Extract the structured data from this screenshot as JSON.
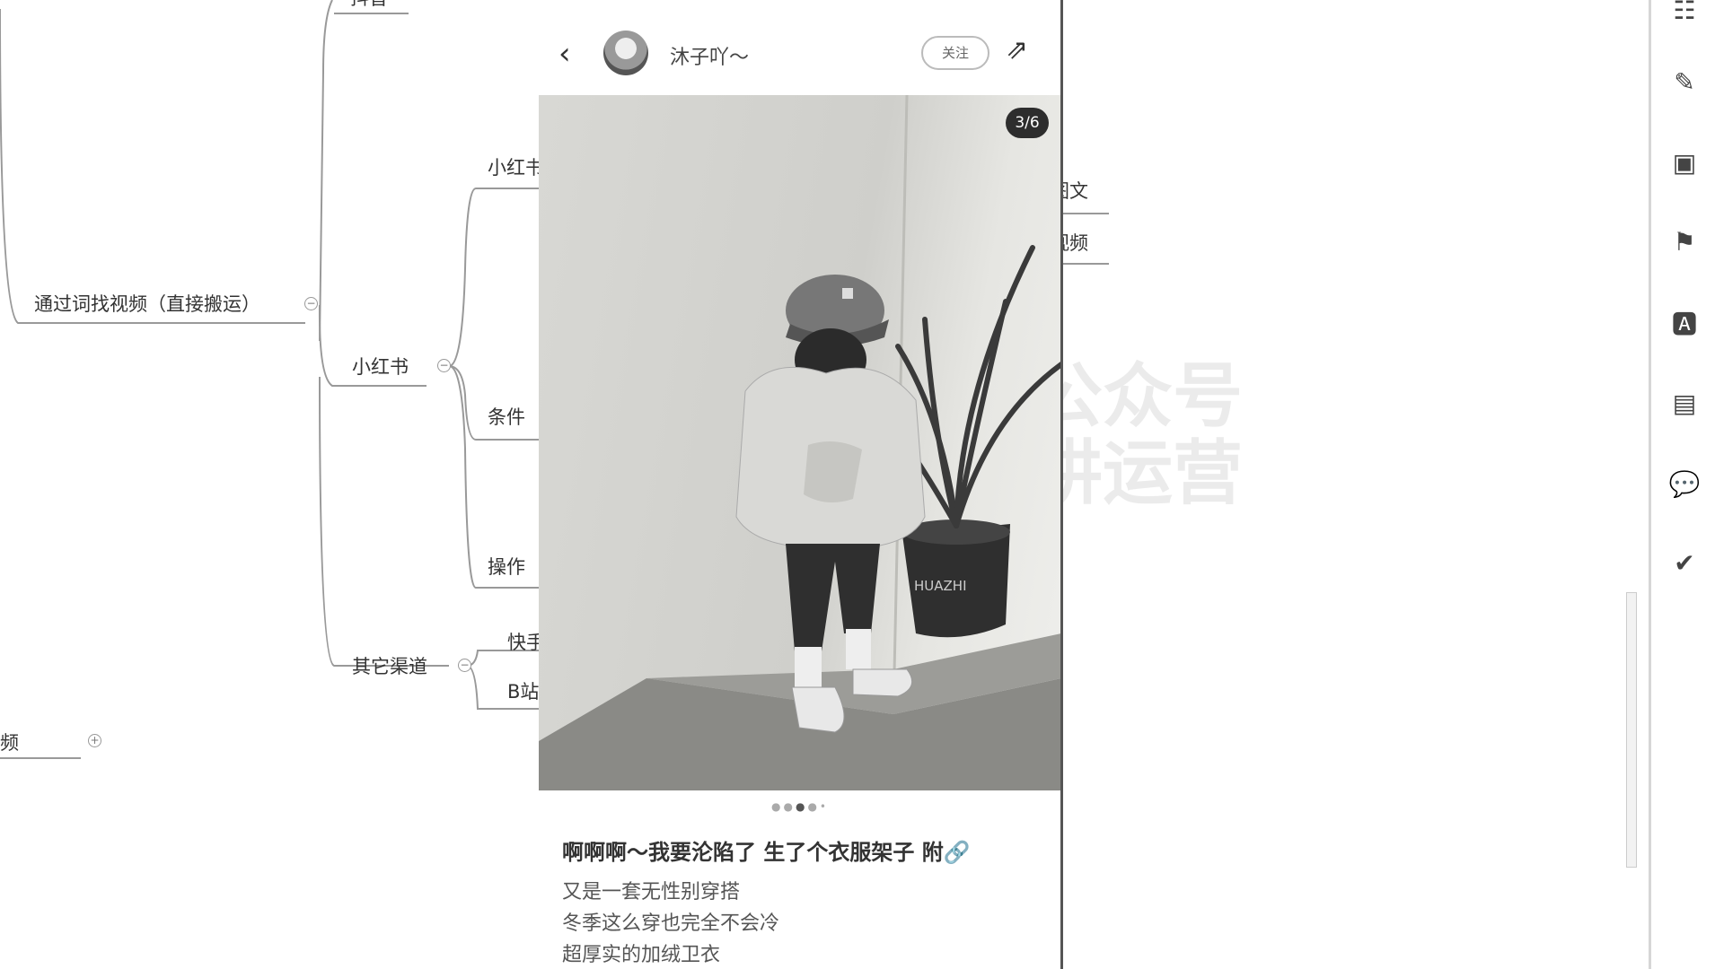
{
  "mindmap": {
    "nodes": {
      "top_cut": "抖音",
      "find_by_words": "通过词找视频（直接搬运）",
      "xiaohongshu": "小红书",
      "xhs_child": "小红书",
      "conditions": "条件",
      "operation": "操作",
      "other_channels": "其它渠道",
      "kuaishou": "快手",
      "bilibili": "B站",
      "find_video": "找视频",
      "image_text": "图文",
      "video": "视频"
    }
  },
  "phone": {
    "username": "沐子吖～",
    "follow_label": "关注",
    "image_counter": "3/6",
    "image_total": 6,
    "image_current": 3,
    "post_title": "啊啊啊～我要沦陷了 生了个衣服架子 附🔗",
    "post_lines": [
      "又是一套无性别穿搭",
      "冬季这么穿也完全不会冷",
      "超厚实的加绒卫衣"
    ],
    "pot_text": "HUAZHI"
  },
  "toolbar": {
    "icons": [
      "layout-icon",
      "brush-icon",
      "image-icon",
      "flag-icon",
      "text-style-icon",
      "document-icon",
      "comment-icon",
      "clipboard-check-icon"
    ]
  },
  "watermark": {
    "line1": "公众号",
    "line2": "讲运营"
  }
}
